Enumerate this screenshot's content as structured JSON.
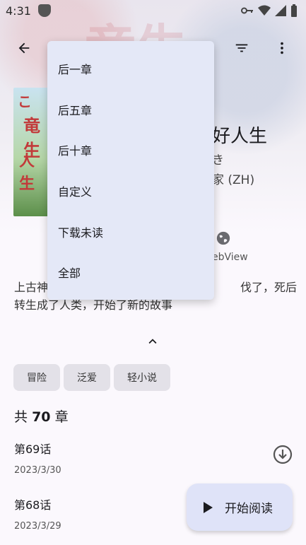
{
  "status_bar": {
    "time": "4:31"
  },
  "toolbar": {
    "back_icon": "arrow-back-icon",
    "filter_icon": "filter-icon",
    "more_icon": "more-vert-icon"
  },
  "manga": {
    "title_fragment": "好人生",
    "author_fragment": "き",
    "source_fragment": "家 (ZH)",
    "webview_label": "ebView",
    "description": "上古神　　　　　　　　　　　　　　　　　伐了，死后转生成了人类，开始了新的故事"
  },
  "tags": [
    "冒险",
    "泛爱",
    "轻小说"
  ],
  "chapter_count": {
    "prefix": "共",
    "number": "70",
    "suffix": "章"
  },
  "chapters": [
    {
      "name": "第69话",
      "date": "2023/3/30"
    },
    {
      "name": "第68话",
      "date": "2023/3/29"
    }
  ],
  "fab": {
    "label": "开始阅读"
  },
  "download_menu": {
    "items": [
      "后一章",
      "后五章",
      "后十章",
      "自定义",
      "下载未读",
      "全部"
    ]
  },
  "colors": {
    "menu_bg": "#e4e8f7",
    "fab_bg": "#dfe3f8",
    "tag_bg": "#e3e1e8"
  }
}
